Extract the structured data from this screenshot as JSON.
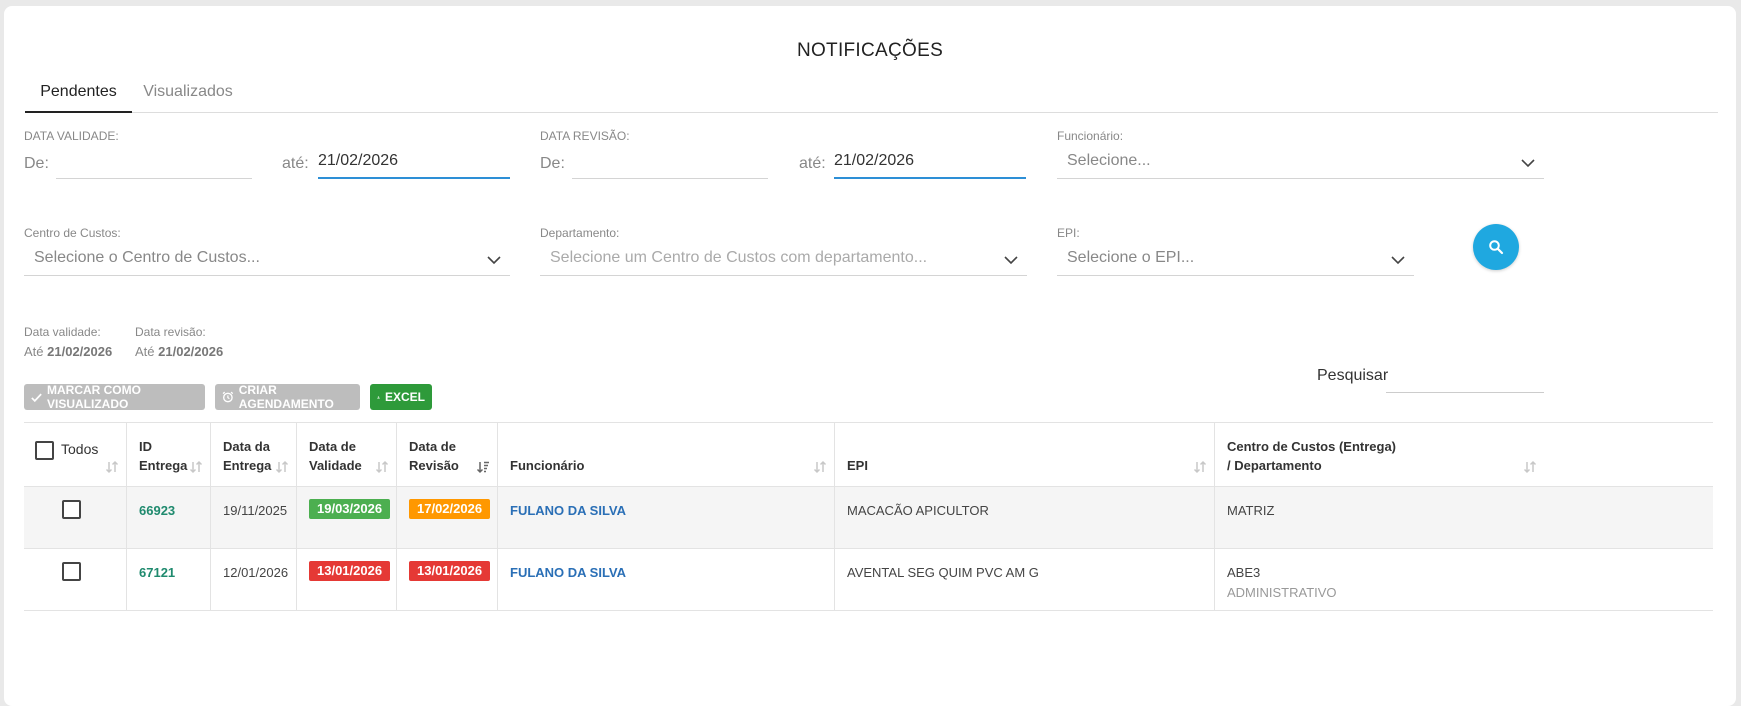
{
  "page_title": "NOTIFICAÇÕES",
  "tabs": [
    "Pendentes",
    "Visualizados"
  ],
  "filters": {
    "data_validade": {
      "label": "DATA VALIDADE:",
      "de_label": "De:",
      "de_value": "",
      "ate_label": "até:",
      "ate_value": "21/02/2026"
    },
    "data_revisao": {
      "label": "DATA REVISÃO:",
      "de_label": "De:",
      "de_value": "",
      "ate_label": "até:",
      "ate_value": "21/02/2026"
    },
    "funcionario": {
      "label": "Funcionário:",
      "placeholder": "Selecione..."
    },
    "centro_custos": {
      "label": "Centro de Custos:",
      "placeholder": "Selecione o Centro de Custos..."
    },
    "departamento": {
      "label": "Departamento:",
      "placeholder": "Selecione um Centro de Custos com departamento..."
    },
    "epi": {
      "label": "EPI:",
      "placeholder": "Selecione o EPI..."
    }
  },
  "summary": {
    "validade_label": "Data validade:",
    "validade_prefix": "Até",
    "validade_value": "21/02/2026",
    "revisao_label": "Data revisão:",
    "revisao_prefix": "Até",
    "revisao_value": "21/02/2026"
  },
  "actions": {
    "marcar": "MARCAR COMO VISUALIZADO",
    "agendamento": "CRIAR AGENDAMENTO",
    "excel": "EXCEL"
  },
  "search": {
    "label": "Pesquisar",
    "value": ""
  },
  "table": {
    "headers": {
      "todos": "Todos",
      "id_1": "ID",
      "id_2": "Entrega",
      "entrega_1": "Data da",
      "entrega_2": "Entrega",
      "validade_1": "Data de",
      "validade_2": "Validade",
      "revisao_1": "Data de",
      "revisao_2": "Revisão",
      "funcionario": "Funcionário",
      "epi": "EPI",
      "cc_1": "Centro de Custos (Entrega)",
      "cc_2": "/ Departamento"
    },
    "rows": [
      {
        "id": "66923",
        "data_entrega": "19/11/2025",
        "data_validade": "19/03/2026",
        "validade_status": "green",
        "data_revisao": "17/02/2026",
        "revisao_status": "orange",
        "funcionario": "FULANO DA SILVA",
        "epi": "MACACÃO APICULTOR",
        "centro_custos": "MATRIZ",
        "departamento": ""
      },
      {
        "id": "67121",
        "data_entrega": "12/01/2026",
        "data_validade": "13/01/2026",
        "validade_status": "red",
        "data_revisao": "13/01/2026",
        "revisao_status": "red",
        "funcionario": "FULANO DA SILVA",
        "epi": "AVENTAL SEG QUIM PVC AM G",
        "centro_custos": "ABE3",
        "departamento": "ADMINISTRATIVO"
      }
    ]
  },
  "colors": {
    "accent": "#2d8fd6",
    "search_button": "#1fa8e0",
    "excel": "#2e9a3a",
    "id_link": "#1f8a6e",
    "name_link": "#2a6fb6",
    "badge_green": "#4caf50",
    "badge_orange": "#ff9800",
    "badge_red": "#e53935"
  },
  "icons": {
    "search": "search-icon",
    "check": "check-icon",
    "alarm": "alarm-clock-icon",
    "download": "download-icon",
    "chevron": "chevron-down-icon",
    "sort": "sort-icon"
  }
}
